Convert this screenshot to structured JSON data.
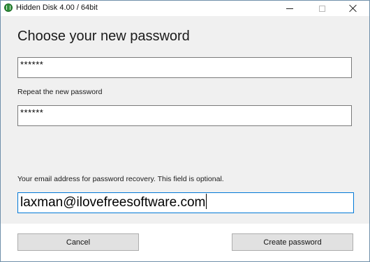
{
  "window": {
    "title": "Hidden Disk 4.00 / 64bit",
    "controls": {
      "minimize": "minimize-icon",
      "maximize": "maximize-icon",
      "close": "close-icon"
    }
  },
  "form": {
    "heading": "Choose your new password",
    "password_value": "******",
    "repeat_label": "Repeat the new password",
    "repeat_value": "******",
    "email_label": "Your email address for password recovery. This field is optional.",
    "email_value": "laxman@ilovefreesoftware.com"
  },
  "buttons": {
    "cancel": "Cancel",
    "create": "Create password"
  },
  "colors": {
    "focus_border": "#0078d7",
    "app_icon": "#2f8f3a"
  }
}
